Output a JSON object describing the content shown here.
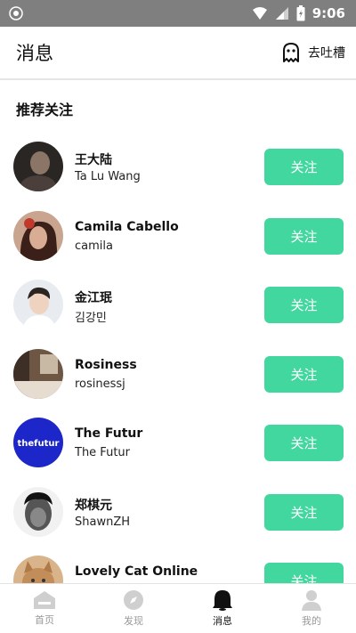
{
  "status_bar": {
    "time": "9:06"
  },
  "header": {
    "title": "消息",
    "complain_label": "去吐槽"
  },
  "section": {
    "title": "推荐关注"
  },
  "users": [
    {
      "name": "王大陆",
      "sub": "Ta Lu Wang",
      "follow_label": "关注"
    },
    {
      "name": "Camila Cabello",
      "sub": "camila",
      "follow_label": "关注"
    },
    {
      "name": "金江珉",
      "sub": "김강민",
      "follow_label": "关注"
    },
    {
      "name": "Rosiness",
      "sub": "rosinessj",
      "follow_label": "关注"
    },
    {
      "name": "The Futur",
      "sub": "The Futur",
      "follow_label": "关注",
      "avatar_text": "thefutur"
    },
    {
      "name": "郑棋元",
      "sub": "ShawnZH",
      "follow_label": "关注"
    },
    {
      "name": "Lovely Cat Online",
      "sub": "",
      "follow_label": "关注"
    }
  ],
  "tabbar": {
    "tabs": [
      {
        "label": "首页",
        "icon": "home-icon"
      },
      {
        "label": "发现",
        "icon": "compass-icon"
      },
      {
        "label": "消息",
        "icon": "bell-icon",
        "active": true
      },
      {
        "label": "我的",
        "icon": "profile-icon"
      }
    ]
  },
  "colors": {
    "accent": "#43d7a0",
    "status_bar": "#7f7f7f"
  }
}
